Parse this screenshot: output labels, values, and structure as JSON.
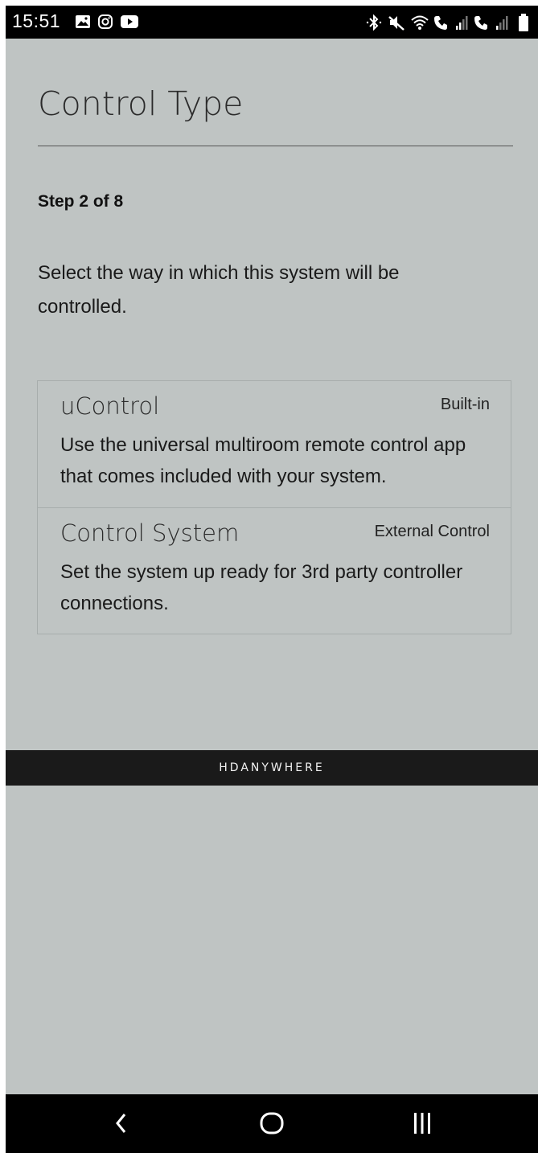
{
  "status_bar": {
    "time": "15:51",
    "left_icons": [
      "gallery-icon",
      "instagram-icon",
      "youtube-icon"
    ],
    "right_icons": [
      "bluetooth-icon",
      "mute-icon",
      "wifi-icon",
      "sim1-signal-icon",
      "sim2-signal-icon",
      "battery-icon"
    ]
  },
  "page": {
    "title": "Control Type",
    "step": "Step 2 of 8",
    "instructions": "Select the way in which this system will be controlled."
  },
  "options": [
    {
      "title": "uControl",
      "tag": "Built-in",
      "description": "Use the universal multiroom remote control app that comes included with your system."
    },
    {
      "title": "Control System",
      "tag": "External Control",
      "description": "Set the system up ready for 3rd party controller connections."
    }
  ],
  "brand": {
    "name": "HDANYWHERE"
  },
  "nav_bar": {
    "buttons": [
      "back-icon",
      "home-icon",
      "recents-icon"
    ]
  },
  "colors": {
    "background": "#bfc4c3",
    "bars": "#000000",
    "brand_bar": "#1a1a1a",
    "border": "#a7adac"
  }
}
